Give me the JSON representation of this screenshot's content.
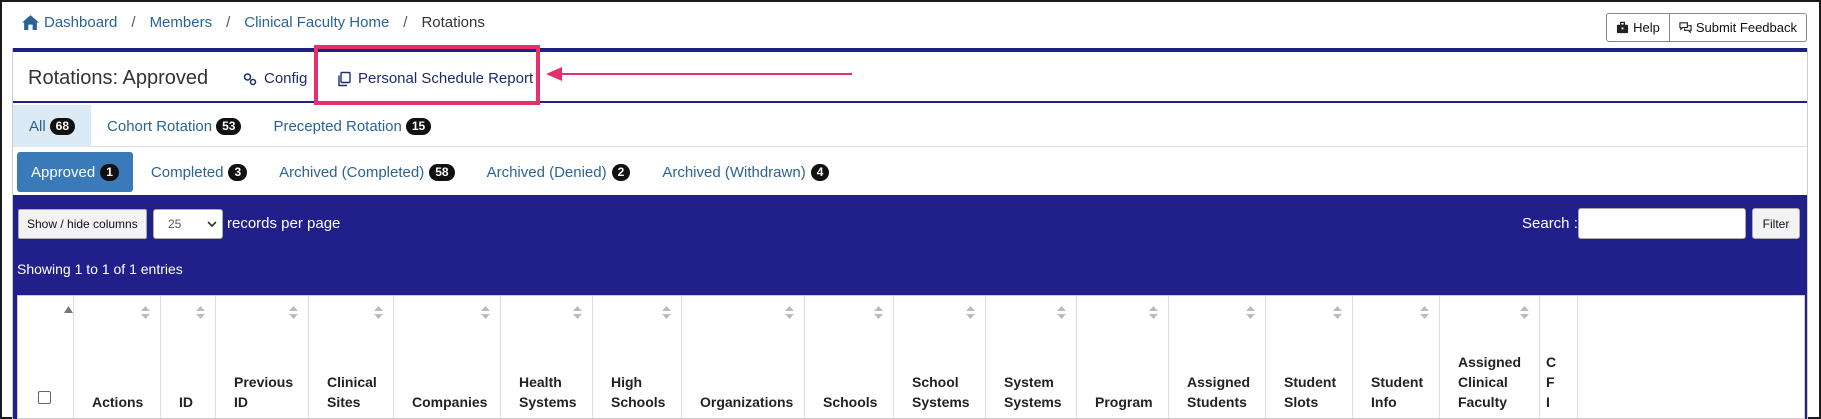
{
  "breadcrumb": {
    "items": [
      "Dashboard",
      "Members",
      "Clinical Faculty Home"
    ],
    "current": "Rotations",
    "separator": "/"
  },
  "top_buttons": {
    "help": "Help",
    "feedback": "Submit Feedback"
  },
  "header": {
    "title": "Rotations: Approved",
    "config": "Config",
    "report": "Personal Schedule Report"
  },
  "tabs_primary": [
    {
      "label": "All",
      "count": "68",
      "active": true
    },
    {
      "label": "Cohort Rotation",
      "count": "53"
    },
    {
      "label": "Precepted Rotation",
      "count": "15"
    }
  ],
  "tabs_status": [
    {
      "label": "Approved",
      "count": "1",
      "active": true
    },
    {
      "label": "Completed",
      "count": "3"
    },
    {
      "label": "Archived (Completed)",
      "count": "58"
    },
    {
      "label": "Archived (Denied)",
      "count": "2"
    },
    {
      "label": "Archived (Withdrawn)",
      "count": "4"
    }
  ],
  "toolbar": {
    "show_hide": "Show / hide columns",
    "per_page_value": "25",
    "per_page_label": "records per page",
    "search_label": "Search :",
    "search_value": "",
    "filter": "Filter",
    "showing": "Showing 1 to 1 of 1 entries"
  },
  "columns": [
    {
      "name": "",
      "lines": []
    },
    {
      "name": "actions",
      "lines": [
        "Actions"
      ]
    },
    {
      "name": "id",
      "lines": [
        "ID"
      ]
    },
    {
      "name": "previous-id",
      "lines": [
        "Previous",
        "ID"
      ]
    },
    {
      "name": "clinical-sites",
      "lines": [
        "Clinical",
        "Sites"
      ]
    },
    {
      "name": "companies",
      "lines": [
        "Companies"
      ]
    },
    {
      "name": "health-systems",
      "lines": [
        "Health",
        "Systems"
      ]
    },
    {
      "name": "high-schools",
      "lines": [
        "High",
        "Schools"
      ]
    },
    {
      "name": "organizations",
      "lines": [
        "Organizations"
      ]
    },
    {
      "name": "schools",
      "lines": [
        "Schools"
      ]
    },
    {
      "name": "school-systems",
      "lines": [
        "School",
        "Systems"
      ]
    },
    {
      "name": "system-systems",
      "lines": [
        "System",
        "Systems"
      ]
    },
    {
      "name": "program",
      "lines": [
        "Program"
      ]
    },
    {
      "name": "assigned-students",
      "lines": [
        "Assigned",
        "Students"
      ]
    },
    {
      "name": "student-slots",
      "lines": [
        "Student",
        "Slots"
      ]
    },
    {
      "name": "student-info",
      "lines": [
        "Student",
        "Info"
      ]
    },
    {
      "name": "assigned-clinical-faculty",
      "lines": [
        "Assigned",
        "Clinical",
        "Faculty"
      ]
    },
    {
      "name": "truncated",
      "lines": [
        "C",
        "F",
        "I"
      ]
    }
  ],
  "colors": {
    "accent": "#1f2182",
    "highlight": "#e5306b",
    "link": "#2a6496"
  }
}
